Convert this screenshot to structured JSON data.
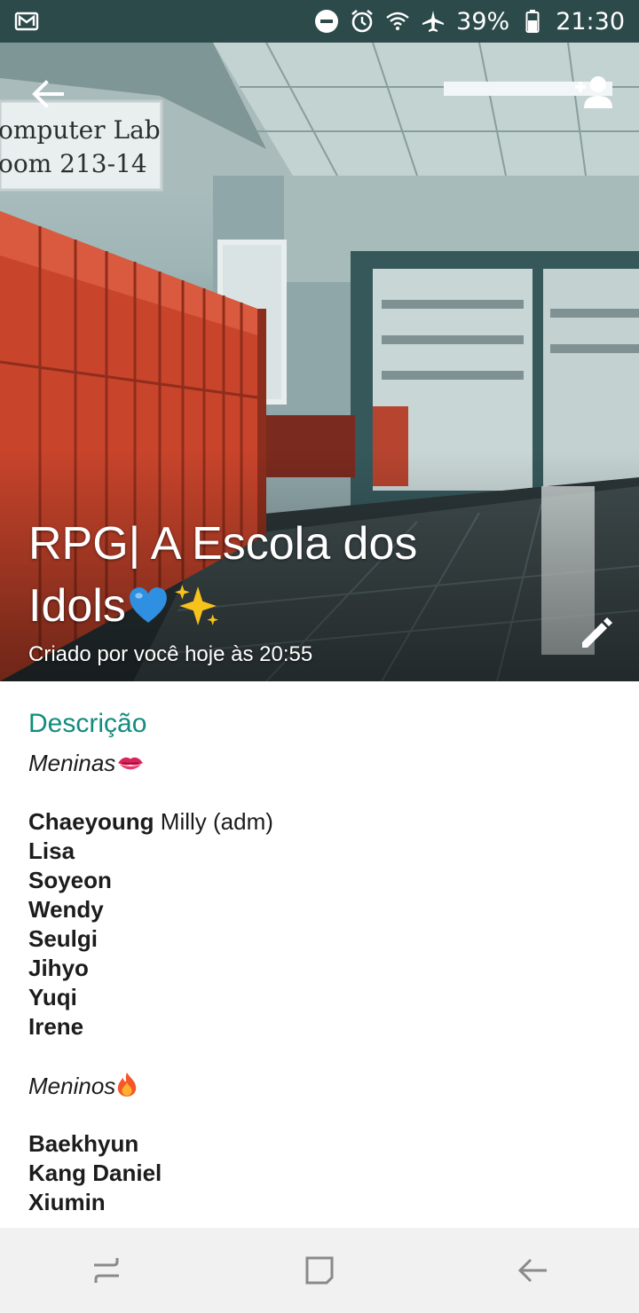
{
  "status_bar": {
    "battery": "39%",
    "time": "21:30",
    "icons": [
      "gmail-icon",
      "do-not-disturb-icon",
      "alarm-icon",
      "wifi-icon",
      "airplane-icon",
      "battery-icon"
    ]
  },
  "header": {
    "title_line1": "RPG| A Escola dos",
    "title_line2": "Idols",
    "title_emoji": [
      "blue-heart-emoji",
      "sparkles-emoji"
    ],
    "created_by": "Criado por você hoje às 20:55",
    "sign_line1": "omputer Lab",
    "sign_line2": "oom 213-14"
  },
  "description": {
    "heading": "Descrição",
    "girls_label": "Meninas",
    "girls": [
      {
        "name": "Chaeyoung",
        "note": " Milly (adm)"
      },
      {
        "name": "Lisa",
        "note": ""
      },
      {
        "name": "Soyeon",
        "note": ""
      },
      {
        "name": "Wendy",
        "note": ""
      },
      {
        "name": "Seulgi",
        "note": ""
      },
      {
        "name": "Jihyo",
        "note": ""
      },
      {
        "name": "Yuqi",
        "note": ""
      },
      {
        "name": "Irene",
        "note": ""
      }
    ],
    "boys_label": "Meninos",
    "boys": [
      {
        "name": "Baekhyun",
        "note": ""
      },
      {
        "name": "Kang Daniel",
        "note": ""
      },
      {
        "name": "Xiumin",
        "note": ""
      }
    ]
  },
  "colors": {
    "status_bar": "#2c4a4a",
    "accent": "#128c7e",
    "lockers": "#c8442b"
  }
}
